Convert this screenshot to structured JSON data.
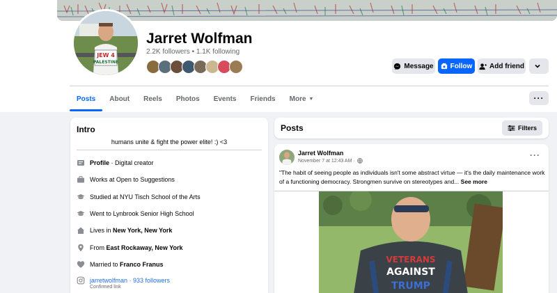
{
  "profile": {
    "name": "Jarret Wolfman",
    "stats": "2.2K followers • 1.1K following",
    "friend_avatar_colors": [
      "#8a6b3e",
      "#5a6e7c",
      "#6b4f3a",
      "#3f5a6e",
      "#7a6a5a",
      "#c9b890",
      "#d74b5b",
      "#9a7b52"
    ]
  },
  "actions": {
    "message": "Message",
    "follow": "Follow",
    "add_friend": "Add friend"
  },
  "tabs": [
    {
      "label": "Posts"
    },
    {
      "label": "About"
    },
    {
      "label": "Reels"
    },
    {
      "label": "Photos"
    },
    {
      "label": "Events"
    },
    {
      "label": "Friends"
    },
    {
      "label": "More"
    }
  ],
  "intro": {
    "title": "Intro",
    "bio": "humans unite & fight the power elite! :) <3",
    "profile_label": "Profile",
    "profile_value": " · Digital creator",
    "work": "Works at Open to Suggestions",
    "studied": "Studied at NYU Tisch School of the Arts",
    "went": "Went to Lynbrook Senior High School",
    "lives_prefix": "Lives in ",
    "lives_value": "New York, New York",
    "from_prefix": "From ",
    "from_value": "East Rockaway, New York",
    "married_prefix": "Married to ",
    "married_value": "Franco Franus",
    "instagram": "jarretwolfman · 933 followers",
    "instagram_sub": "Confirmed link"
  },
  "posts": {
    "title": "Posts",
    "filters": "Filters"
  },
  "post": {
    "author": "Jarret Wolfman",
    "time": "November 7 at 12:43 AM · ",
    "text": "\"The habit of seeing people as individuals isn't some abstract virtue — it's the daily maintenance work of a functioning democracy. Strongmen survive on stereotypes and... ",
    "see_more": "See more",
    "shirt_line1": "VETERANS",
    "shirt_line2": "AGAINST",
    "shirt_line3": "TRUMP"
  },
  "avatar_sign": {
    "line1": "JEW 4",
    "line2": "PALESTINE"
  },
  "colors": {
    "accent": "#0866ff",
    "link": "#216fdb",
    "secondary_text": "#65676b",
    "button_gray": "#e4e6eb"
  }
}
